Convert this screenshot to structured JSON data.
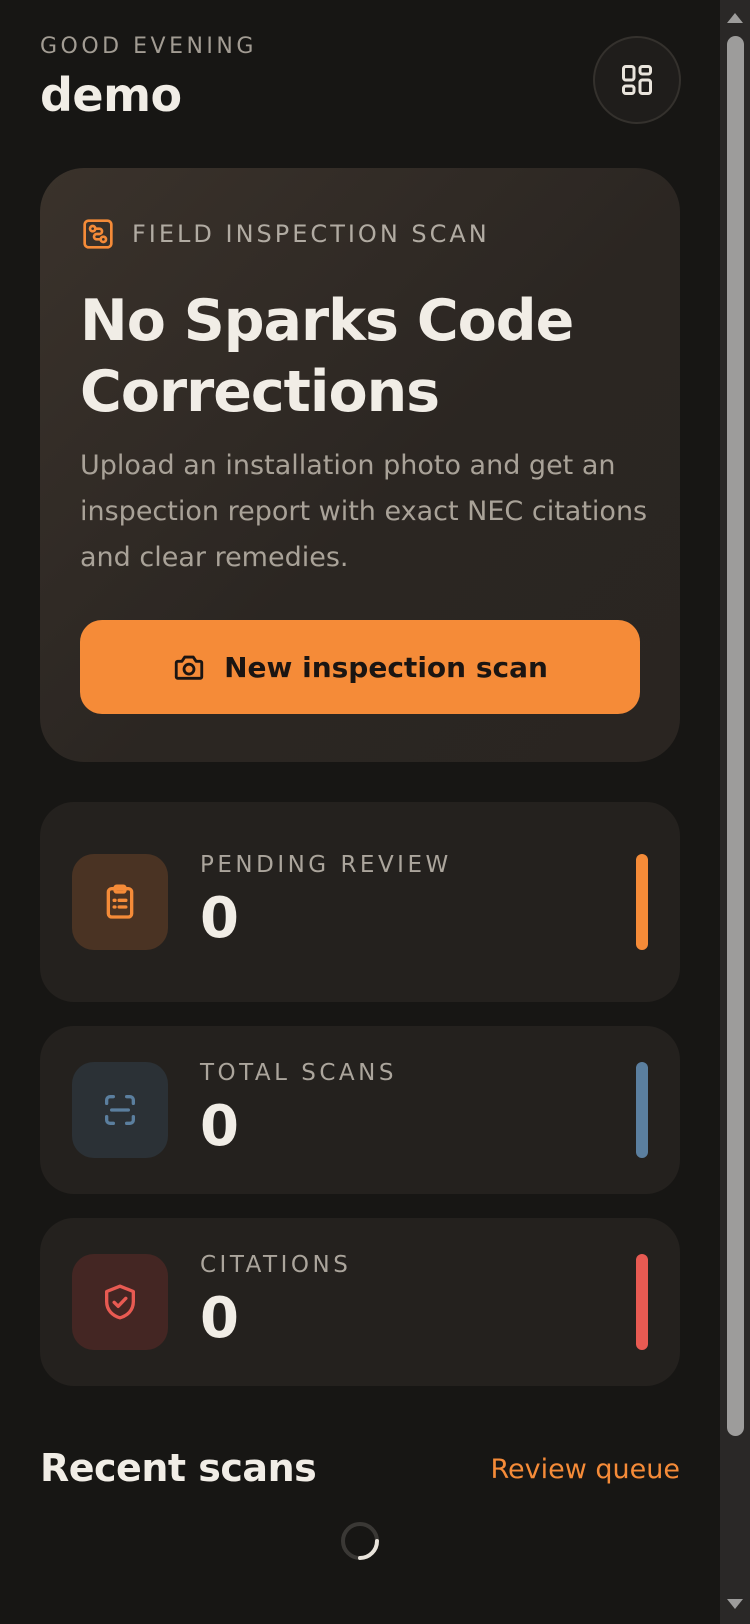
{
  "header": {
    "greeting": "GOOD EVENING",
    "username": "demo",
    "menu_icon": "grid-icon"
  },
  "hero": {
    "tag_icon": "circuit-icon",
    "tag_label": "FIELD INSPECTION SCAN",
    "title": "No Sparks Code Corrections",
    "description": "Upload an installation photo and get an inspection report with exact NEC citations and clear remedies.",
    "button_icon": "camera-icon",
    "button_label": "New inspection scan"
  },
  "stats": [
    {
      "label": "PENDING REVIEW",
      "value": "0",
      "icon": "clipboard-icon",
      "accent": "#f58b38"
    },
    {
      "label": "TOTAL SCANS",
      "value": "0",
      "icon": "scan-icon",
      "accent": "#5b7f9f"
    },
    {
      "label": "CITATIONS",
      "value": "0",
      "icon": "shield-check-icon",
      "accent": "#e85a52"
    }
  ],
  "recent": {
    "title": "Recent scans",
    "link_label": "Review queue",
    "loading_icon": "spinner-icon"
  },
  "colors": {
    "accent": "#f58b38",
    "background": "#171614",
    "card": "#24211e"
  }
}
